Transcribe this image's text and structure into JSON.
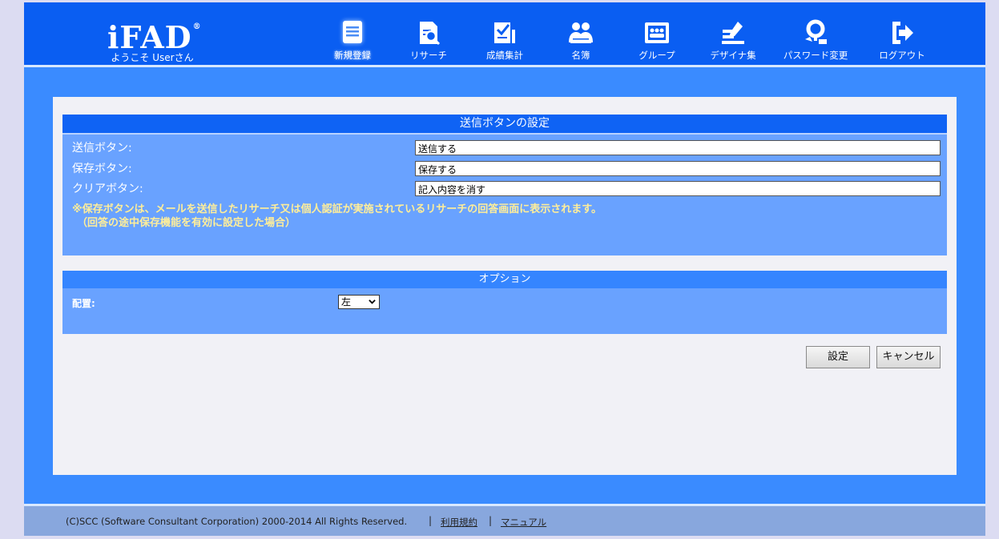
{
  "header": {
    "logo": "iFAD",
    "logo_mark": "®",
    "welcome": "ようこそ Userさん"
  },
  "nav": [
    {
      "label": "新規登録",
      "icon": "new-document-icon"
    },
    {
      "label": "リサーチ",
      "icon": "research-icon"
    },
    {
      "label": "成績集計",
      "icon": "results-icon"
    },
    {
      "label": "名簿",
      "icon": "roster-icon"
    },
    {
      "label": "グループ",
      "icon": "group-icon"
    },
    {
      "label": "デザイナ集",
      "icon": "designer-icon"
    },
    {
      "label": "パスワード変更",
      "icon": "password-icon"
    },
    {
      "label": "ログアウト",
      "icon": "logout-icon"
    }
  ],
  "submit_section": {
    "title": "送信ボタンの設定",
    "rows": [
      {
        "label": "送信ボタン:",
        "value": "送信する"
      },
      {
        "label": "保存ボタン:",
        "value": "保存する"
      },
      {
        "label": "クリアボタン:",
        "value": "記入内容を消す"
      }
    ],
    "note_line1": "※保存ボタンは、メールを送信したリサーチ又は個人認証が実施されているリサーチの回答画面に表示されます。",
    "note_line2": "（回答の途中保存機能を有効に設定した場合）"
  },
  "option_section": {
    "title": "オプション",
    "layout_label": "配置:",
    "layout_value": "左"
  },
  "buttons": {
    "set": "設定",
    "cancel": "キャンセル"
  },
  "footer": {
    "copyright": "(C)SCC (Software Consultant Corporation) 2000-2014 All Rights Reserved.",
    "separator": "|",
    "terms": "利用規約",
    "manual": "マニュアル"
  },
  "colors": {
    "header": "#0a5ef2",
    "outer": "#3a8bff",
    "section": "#69a2ff",
    "note": "#ffee99"
  }
}
